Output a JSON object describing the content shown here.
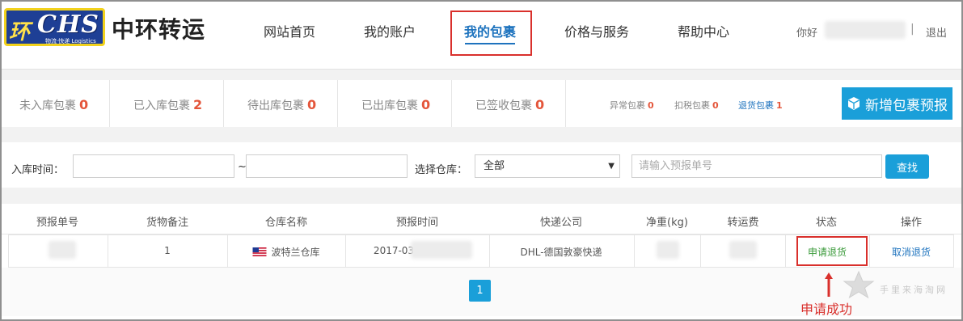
{
  "logo": {
    "mark": "环",
    "text": "CHS",
    "subtitle": "物流·快递 Logistics"
  },
  "brand": "中环转运",
  "nav": {
    "home": "网站首页",
    "account": "我的账户",
    "packages": "我的包裹",
    "pricing": "价格与服务",
    "help": "帮助中心"
  },
  "user": {
    "greeting": "你好",
    "separator": "|",
    "logout": "退出"
  },
  "stats": {
    "not_in": {
      "label": "未入库包裹",
      "count": "0"
    },
    "in": {
      "label": "已入库包裹",
      "count": "2"
    },
    "pending_out": {
      "label": "待出库包裹",
      "count": "0"
    },
    "out": {
      "label": "已出库包裹",
      "count": "0"
    },
    "signed": {
      "label": "已签收包裹",
      "count": "0"
    },
    "abnormal": {
      "label": "异常包裹",
      "count": "0"
    },
    "taxed": {
      "label": "扣税包裹",
      "count": "0"
    },
    "returned": {
      "label": "退货包裹",
      "count": "1"
    }
  },
  "new_button": {
    "label": "新增包裹预报",
    "icon": "cube-icon"
  },
  "filter": {
    "date_label": "入库时间：",
    "tilde": "~",
    "warehouse_label": "选择仓库：",
    "warehouse_selected": "全部",
    "search_placeholder": "请输入预报单号",
    "search_button": "查找"
  },
  "table": {
    "headers": [
      "预报单号",
      "货物备注",
      "仓库名称",
      "预报时间",
      "快递公司",
      "净重(kg)",
      "转运费",
      "状态",
      "操作"
    ],
    "rows": [
      {
        "note": "1",
        "warehouse": "波特兰仓库",
        "time": "2017-03",
        "courier": "DHL-德国敦豪快递",
        "status": "申请退货",
        "action": "取消退货"
      }
    ]
  },
  "pagination": {
    "current": "1"
  },
  "annotation": "申请成功",
  "watermark": "手里来海淘网",
  "colors": {
    "accent": "#1a9fd9",
    "highlight": "#d9302c",
    "count": "#e4563b",
    "status_green": "#3a9a3a"
  }
}
